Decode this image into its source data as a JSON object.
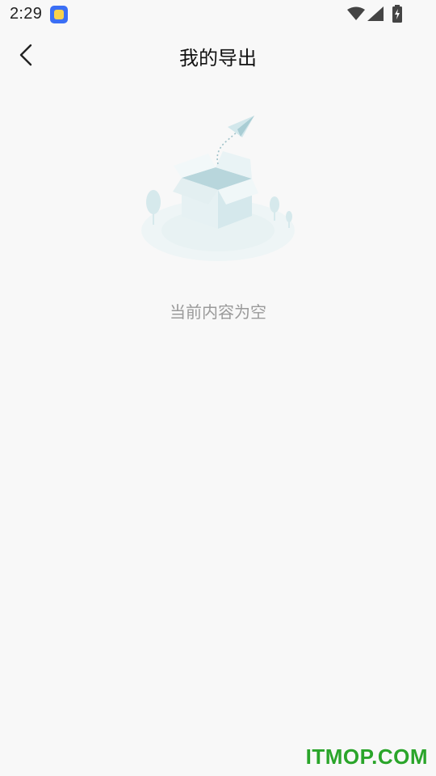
{
  "status_bar": {
    "time": "2:29",
    "icons": [
      "app-notification-icon",
      "wifi-icon",
      "signal-icon",
      "battery-charging-icon"
    ]
  },
  "header": {
    "back_icon": "chevron-left-icon",
    "title": "我的导出"
  },
  "empty_state": {
    "illustration": "empty-box-paper-plane-icon",
    "message": "当前内容为空"
  },
  "watermark": {
    "text": "ITMOP.COM",
    "color": "#2aa52a"
  },
  "colors": {
    "background": "#f8f8f8",
    "title": "#111111",
    "empty_text": "#9a9a9a"
  }
}
